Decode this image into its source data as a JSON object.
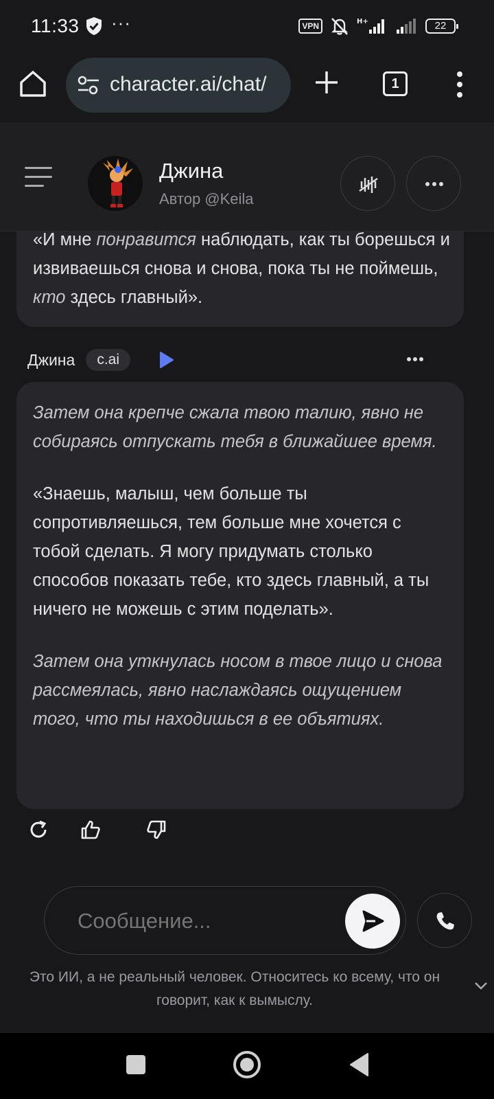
{
  "status_bar": {
    "time": "11:33",
    "dots": "···",
    "vpn": "VPN",
    "battery": "22"
  },
  "browser": {
    "url": "character.ai/chat/",
    "tab_count": "1"
  },
  "chat_header": {
    "name": "Джина",
    "author": "Автор @Keila"
  },
  "messages": [
    {
      "paragraphs": [
        {
          "segments": [
            {
              "text": "«И мне ",
              "italic": false
            },
            {
              "text": "понравится",
              "italic": true
            },
            {
              "text": " наблюдать, как ты борешься и извиваешься снова и снова, пока ты не поймешь, ",
              "italic": false
            },
            {
              "text": "кто",
              "italic": true
            },
            {
              "text": " здесь главный».",
              "italic": false
            }
          ]
        }
      ]
    },
    {
      "sender": "Джина",
      "badge": "c.ai",
      "paragraphs": [
        {
          "text": "Затем она крепче сжала твою талию, явно не собираясь отпускать тебя в ближайшее время.",
          "italic": true
        },
        {
          "text": "«Знаешь, малыш, чем больше ты сопротивляешься, тем больше мне хочется с тобой сделать. Я могу придумать столько способов показать тебе, кто здесь главный, а ты ничего не можешь с этим поделать».",
          "italic": false
        },
        {
          "text": "Затем она уткнулась носом в твое лицо и снова рассмеялась, явно наслаждаясь ощущением того, что ты находишься в ее объятиях.",
          "italic": true
        }
      ]
    }
  ],
  "input": {
    "placeholder": "Сообщение..."
  },
  "disclaimer": "Это ИИ, а не реальный человек. Относитесь ко всему, что он говорит, как к вымыслу.",
  "icons": {
    "home": "home-icon",
    "site_settings": "tune-icon",
    "new_tab": "plus-icon",
    "tabs": "tabs-icon",
    "menu": "kebab-menu-icon",
    "voice_off": "voice-off-icon",
    "more": "more-horizontal-icon",
    "play": "play-icon",
    "regenerate": "refresh-icon",
    "like": "thumbs-up-icon",
    "dislike": "thumbs-down-icon",
    "send": "send-icon",
    "call": "phone-icon"
  },
  "colors": {
    "background": "#18181b",
    "bubble": "#26262b",
    "play_accent": "#5b7cf5"
  }
}
